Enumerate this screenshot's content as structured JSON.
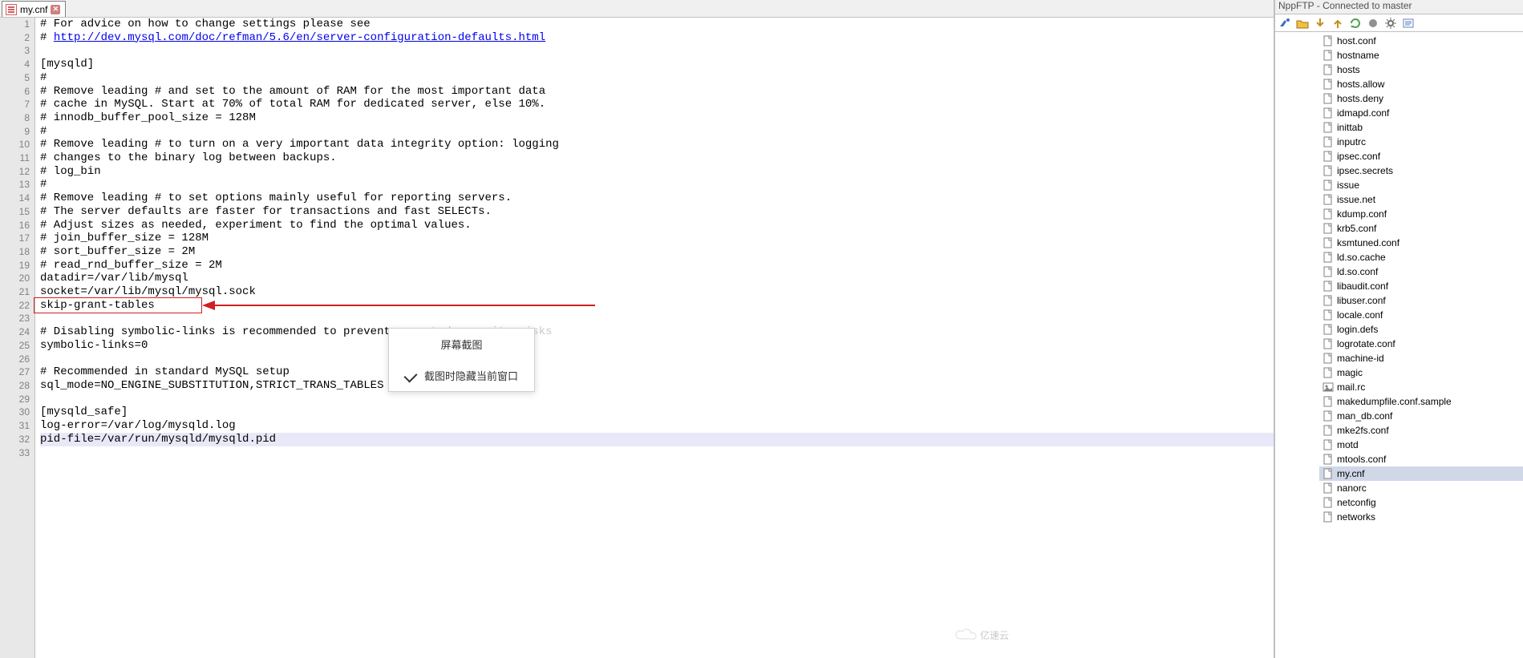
{
  "tab": {
    "filename": "my.cnf"
  },
  "code_lines": [
    "# For advice on how to change settings please see",
    "# http://dev.mysql.com/doc/refman/5.6/en/server-configuration-defaults.html",
    "",
    "[mysqld]",
    "#",
    "# Remove leading # and set to the amount of RAM for the most important data",
    "# cache in MySQL. Start at 70% of total RAM for dedicated server, else 10%.",
    "# innodb_buffer_pool_size = 128M",
    "#",
    "# Remove leading # to turn on a very important data integrity option: logging",
    "# changes to the binary log between backups.",
    "# log_bin",
    "#",
    "# Remove leading # to set options mainly useful for reporting servers.",
    "# The server defaults are faster for transactions and fast SELECTs.",
    "# Adjust sizes as needed, experiment to find the optimal values.",
    "# join_buffer_size = 128M",
    "# sort_buffer_size = 2M",
    "# read_rnd_buffer_size = 2M",
    "datadir=/var/lib/mysql",
    "socket=/var/lib/mysql/mysql.sock",
    "skip-grant-tables",
    "",
    "# Disabling symbolic-links is recommended to prevent assorted security risks",
    "symbolic-links=0",
    "",
    "# Recommended in standard MySQL setup",
    "sql_mode=NO_ENGINE_SUBSTITUTION,STRICT_TRANS_TABLES",
    "",
    "[mysqld_safe]",
    "log-error=/var/log/mysqld.log",
    "pid-file=/var/run/mysqld/mysqld.pid",
    ""
  ],
  "link_line_index": 1,
  "link_text": "http://dev.mysql.com/doc/refman/5.6/en/server-configuration-defaults.html",
  "faded_segment": {
    "line_index": 23,
    "text": "assorted security risks"
  },
  "current_line_index": 31,
  "highlighted_line_index": 21,
  "popup": {
    "title": "屏幕截图",
    "option": "截图时隐藏当前窗口"
  },
  "ftp": {
    "title": "NppFTP - Connected to master",
    "files": [
      {
        "name": "host.conf",
        "sel": false
      },
      {
        "name": "hostname",
        "sel": false
      },
      {
        "name": "hosts",
        "sel": false
      },
      {
        "name": "hosts.allow",
        "sel": false
      },
      {
        "name": "hosts.deny",
        "sel": false
      },
      {
        "name": "idmapd.conf",
        "sel": false
      },
      {
        "name": "inittab",
        "sel": false
      },
      {
        "name": "inputrc",
        "sel": false
      },
      {
        "name": "ipsec.conf",
        "sel": false
      },
      {
        "name": "ipsec.secrets",
        "sel": false
      },
      {
        "name": "issue",
        "sel": false
      },
      {
        "name": "issue.net",
        "sel": false
      },
      {
        "name": "kdump.conf",
        "sel": false
      },
      {
        "name": "krb5.conf",
        "sel": false
      },
      {
        "name": "ksmtuned.conf",
        "sel": false
      },
      {
        "name": "ld.so.cache",
        "sel": false
      },
      {
        "name": "ld.so.conf",
        "sel": false
      },
      {
        "name": "libaudit.conf",
        "sel": false
      },
      {
        "name": "libuser.conf",
        "sel": false
      },
      {
        "name": "locale.conf",
        "sel": false
      },
      {
        "name": "login.defs",
        "sel": false
      },
      {
        "name": "logrotate.conf",
        "sel": false
      },
      {
        "name": "machine-id",
        "sel": false
      },
      {
        "name": "magic",
        "sel": false
      },
      {
        "name": "mail.rc",
        "sel": false,
        "img": true
      },
      {
        "name": "makedumpfile.conf.sample",
        "sel": false
      },
      {
        "name": "man_db.conf",
        "sel": false
      },
      {
        "name": "mke2fs.conf",
        "sel": false
      },
      {
        "name": "motd",
        "sel": false
      },
      {
        "name": "mtools.conf",
        "sel": false
      },
      {
        "name": "my.cnf",
        "sel": true
      },
      {
        "name": "nanorc",
        "sel": false
      },
      {
        "name": "netconfig",
        "sel": false
      },
      {
        "name": "networks",
        "sel": false
      }
    ]
  },
  "watermark": "亿速云"
}
